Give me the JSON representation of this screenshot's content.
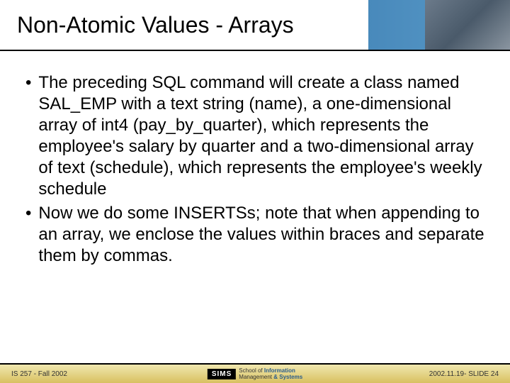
{
  "header": {
    "title": "Non-Atomic Values - Arrays"
  },
  "bullets": [
    "The preceding SQL command will create a class named SAL_EMP with a text string (name), a one-dimensional array of int4 (pay_by_quarter), which represents the employee's salary by quarter and a two-dimensional array of text (schedule), which represents the employee's weekly schedule",
    "Now we do some INSERTSs; note that when appending to an array, we enclose the values within braces and separate them by commas."
  ],
  "footer": {
    "left": "IS 257 - Fall 2002",
    "logo": "SIMS",
    "logoSub1": "School of",
    "logoSub2": "Information",
    "logoSub3": "Management",
    "logoSub4": "& Systems",
    "right": "2002.11.19- SLIDE 24"
  }
}
